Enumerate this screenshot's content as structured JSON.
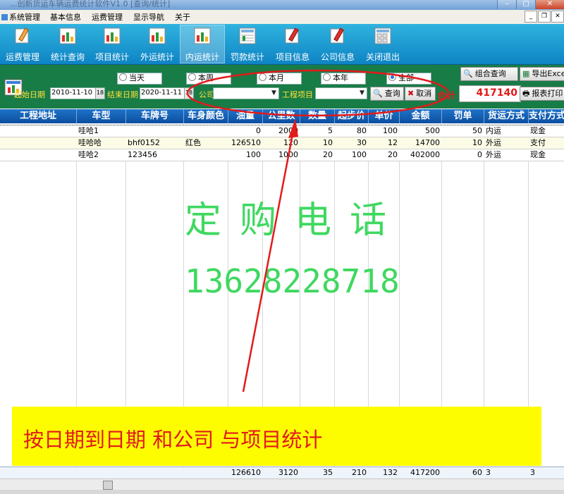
{
  "window": {
    "title": "...创新货运车辆运费统计软件V1.0 [查询/统计]"
  },
  "menubar": {
    "items": [
      "系统管理",
      "基本信息",
      "运费管理",
      "显示导航",
      "关于"
    ]
  },
  "toolbar": {
    "buttons": [
      {
        "label": "运费管理",
        "icon": "pencil-icon"
      },
      {
        "label": "统计查询",
        "icon": "bar-chart-icon"
      },
      {
        "label": "项目统计",
        "icon": "bar-chart-icon"
      },
      {
        "label": "外运统计",
        "icon": "bar-chart-icon"
      },
      {
        "label": "内运统计",
        "icon": "bar-chart-icon"
      },
      {
        "label": "罚款统计",
        "icon": "spreadsheet-icon"
      },
      {
        "label": "项目信息",
        "icon": "pencil-icon"
      },
      {
        "label": "公司信息",
        "icon": "pencil-icon"
      },
      {
        "label": "关闭退出",
        "icon": "spreadsheet-icon"
      }
    ],
    "active_index": 4
  },
  "filters": {
    "radios": [
      {
        "label": "当天",
        "selected": false
      },
      {
        "label": "本周",
        "selected": false
      },
      {
        "label": "本月",
        "selected": false
      },
      {
        "label": "本年",
        "selected": false
      },
      {
        "label": "全部",
        "selected": true
      }
    ],
    "start_label": "起始日期",
    "start_date": "2010-11-10",
    "end_label": "结束日期",
    "end_date": "2020-11-11",
    "company_label": "公司",
    "project_label": "工程项目",
    "query_label": "查询",
    "cancel_label": "取消",
    "total_label": "合计",
    "total_value": "417140",
    "combo_query_label": "组合查询",
    "export_label": "导出Excel",
    "print_label": "报表打印"
  },
  "grid": {
    "columns": [
      "工程地址",
      "车型",
      "车牌号",
      "车身颜色",
      "油量",
      "公里数",
      "数量",
      "起步价",
      "单价",
      "金额",
      "罚单",
      "货运方式",
      "支付方式"
    ],
    "rows": [
      [
        "",
        "哇哈1",
        "",
        "",
        "0",
        "2000",
        "5",
        "80",
        "100",
        "500",
        "50",
        "内运",
        "现金"
      ],
      [
        "",
        "哇哈哈",
        "bhf0152",
        "红色",
        "126510",
        "120",
        "10",
        "30",
        "12",
        "14700",
        "10",
        "外运",
        "支付"
      ],
      [
        "",
        "哇哈2",
        "123456",
        "",
        "100",
        "1000",
        "20",
        "100",
        "20",
        "402000",
        "0",
        "外运",
        "现金"
      ]
    ],
    "totals": [
      "",
      "",
      "",
      "",
      "126610",
      "3120",
      "35",
      "210",
      "132",
      "417200",
      "60",
      "3",
      "3"
    ]
  },
  "watermark": {
    "line1": "定购电话",
    "line2": "13628228718"
  },
  "note": {
    "text": "按日期到日期  和公司 与项目统计"
  },
  "colors": {
    "toolbar": "#1a9ad4",
    "filterbar": "#187c46",
    "header": "#1462b4",
    "watermark": "#3fd860",
    "note_bg": "#fdfd00",
    "annotation": "#e21a1a"
  }
}
